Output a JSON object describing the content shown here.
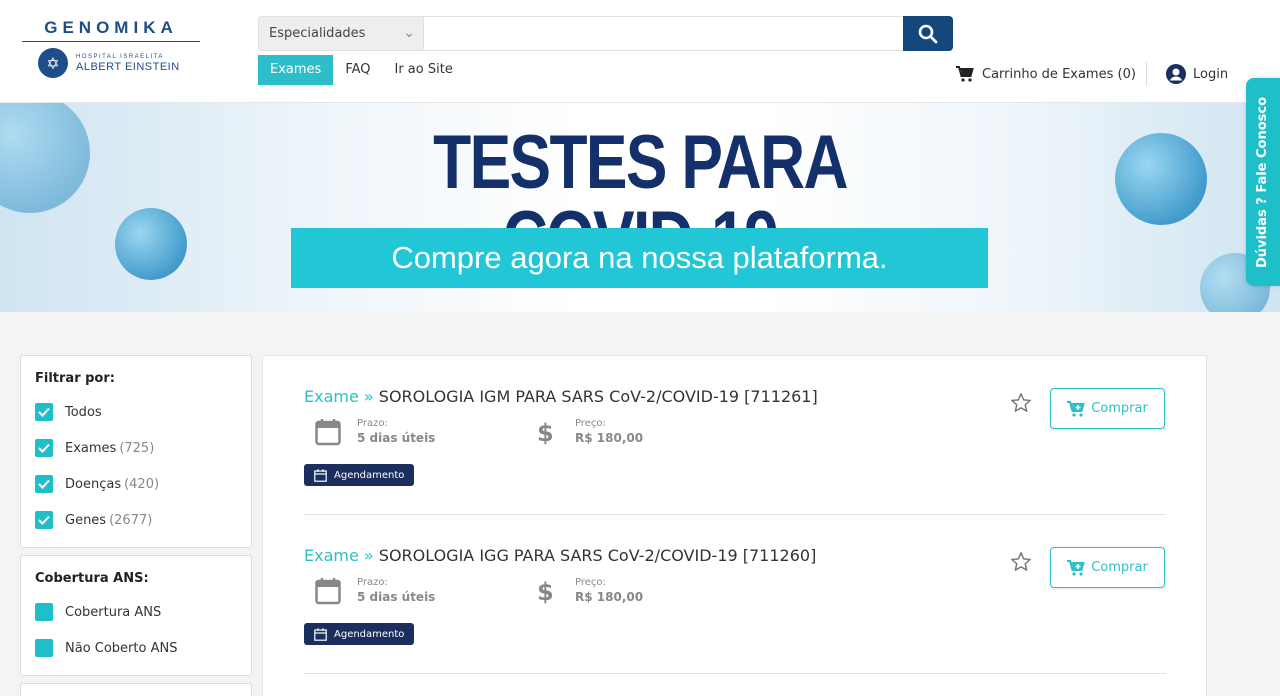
{
  "logo": {
    "word": "GENOMIKA",
    "small": "HOSPITAL ISRAELITA",
    "big": "ALBERT EINSTEIN"
  },
  "search": {
    "select_value": "Especialidades",
    "placeholder": ""
  },
  "nav": {
    "items": [
      "Exames",
      "FAQ",
      "Ir ao Site"
    ],
    "active": "Exames"
  },
  "cart": {
    "label": "Carrinho de Exames (0)"
  },
  "login": {
    "label": "Login"
  },
  "side_tab": {
    "label": "Dúvidas ? Fale Conosco"
  },
  "banner": {
    "title": "TESTES PARA COVID-19",
    "subtitle": "Compre agora na nossa plataforma."
  },
  "filters": {
    "title": "Filtrar por:",
    "items": [
      {
        "label": "Todos",
        "count": ""
      },
      {
        "label": "Exames",
        "count": "(725)"
      },
      {
        "label": "Doenças",
        "count": "(420)"
      },
      {
        "label": "Genes",
        "count": "(2677)"
      }
    ]
  },
  "coverage": {
    "title": "Cobertura ANS:",
    "items": [
      {
        "label": "Cobertura ANS"
      },
      {
        "label": "Não Coberto ANS"
      }
    ]
  },
  "exams": [
    {
      "type": "Exame »",
      "name": "SOROLOGIA IGM PARA SARS CoV-2/COVID-19 [711261]",
      "prazo_label": "Prazo:",
      "prazo": "5 dias úteis",
      "preco_label": "Preço:",
      "preco": "R$ 180,00",
      "badge": "Agendamento",
      "buy": "Comprar"
    },
    {
      "type": "Exame »",
      "name": "SOROLOGIA IGG PARA SARS CoV-2/COVID-19 [711260]",
      "prazo_label": "Prazo:",
      "prazo": "5 dias úteis",
      "preco_label": "Preço:",
      "preco": "R$ 180,00",
      "badge": "Agendamento",
      "buy": "Comprar"
    }
  ],
  "colors": {
    "accent": "#2dbfc9",
    "primary": "#14487d",
    "badge": "#1a2f5e"
  }
}
